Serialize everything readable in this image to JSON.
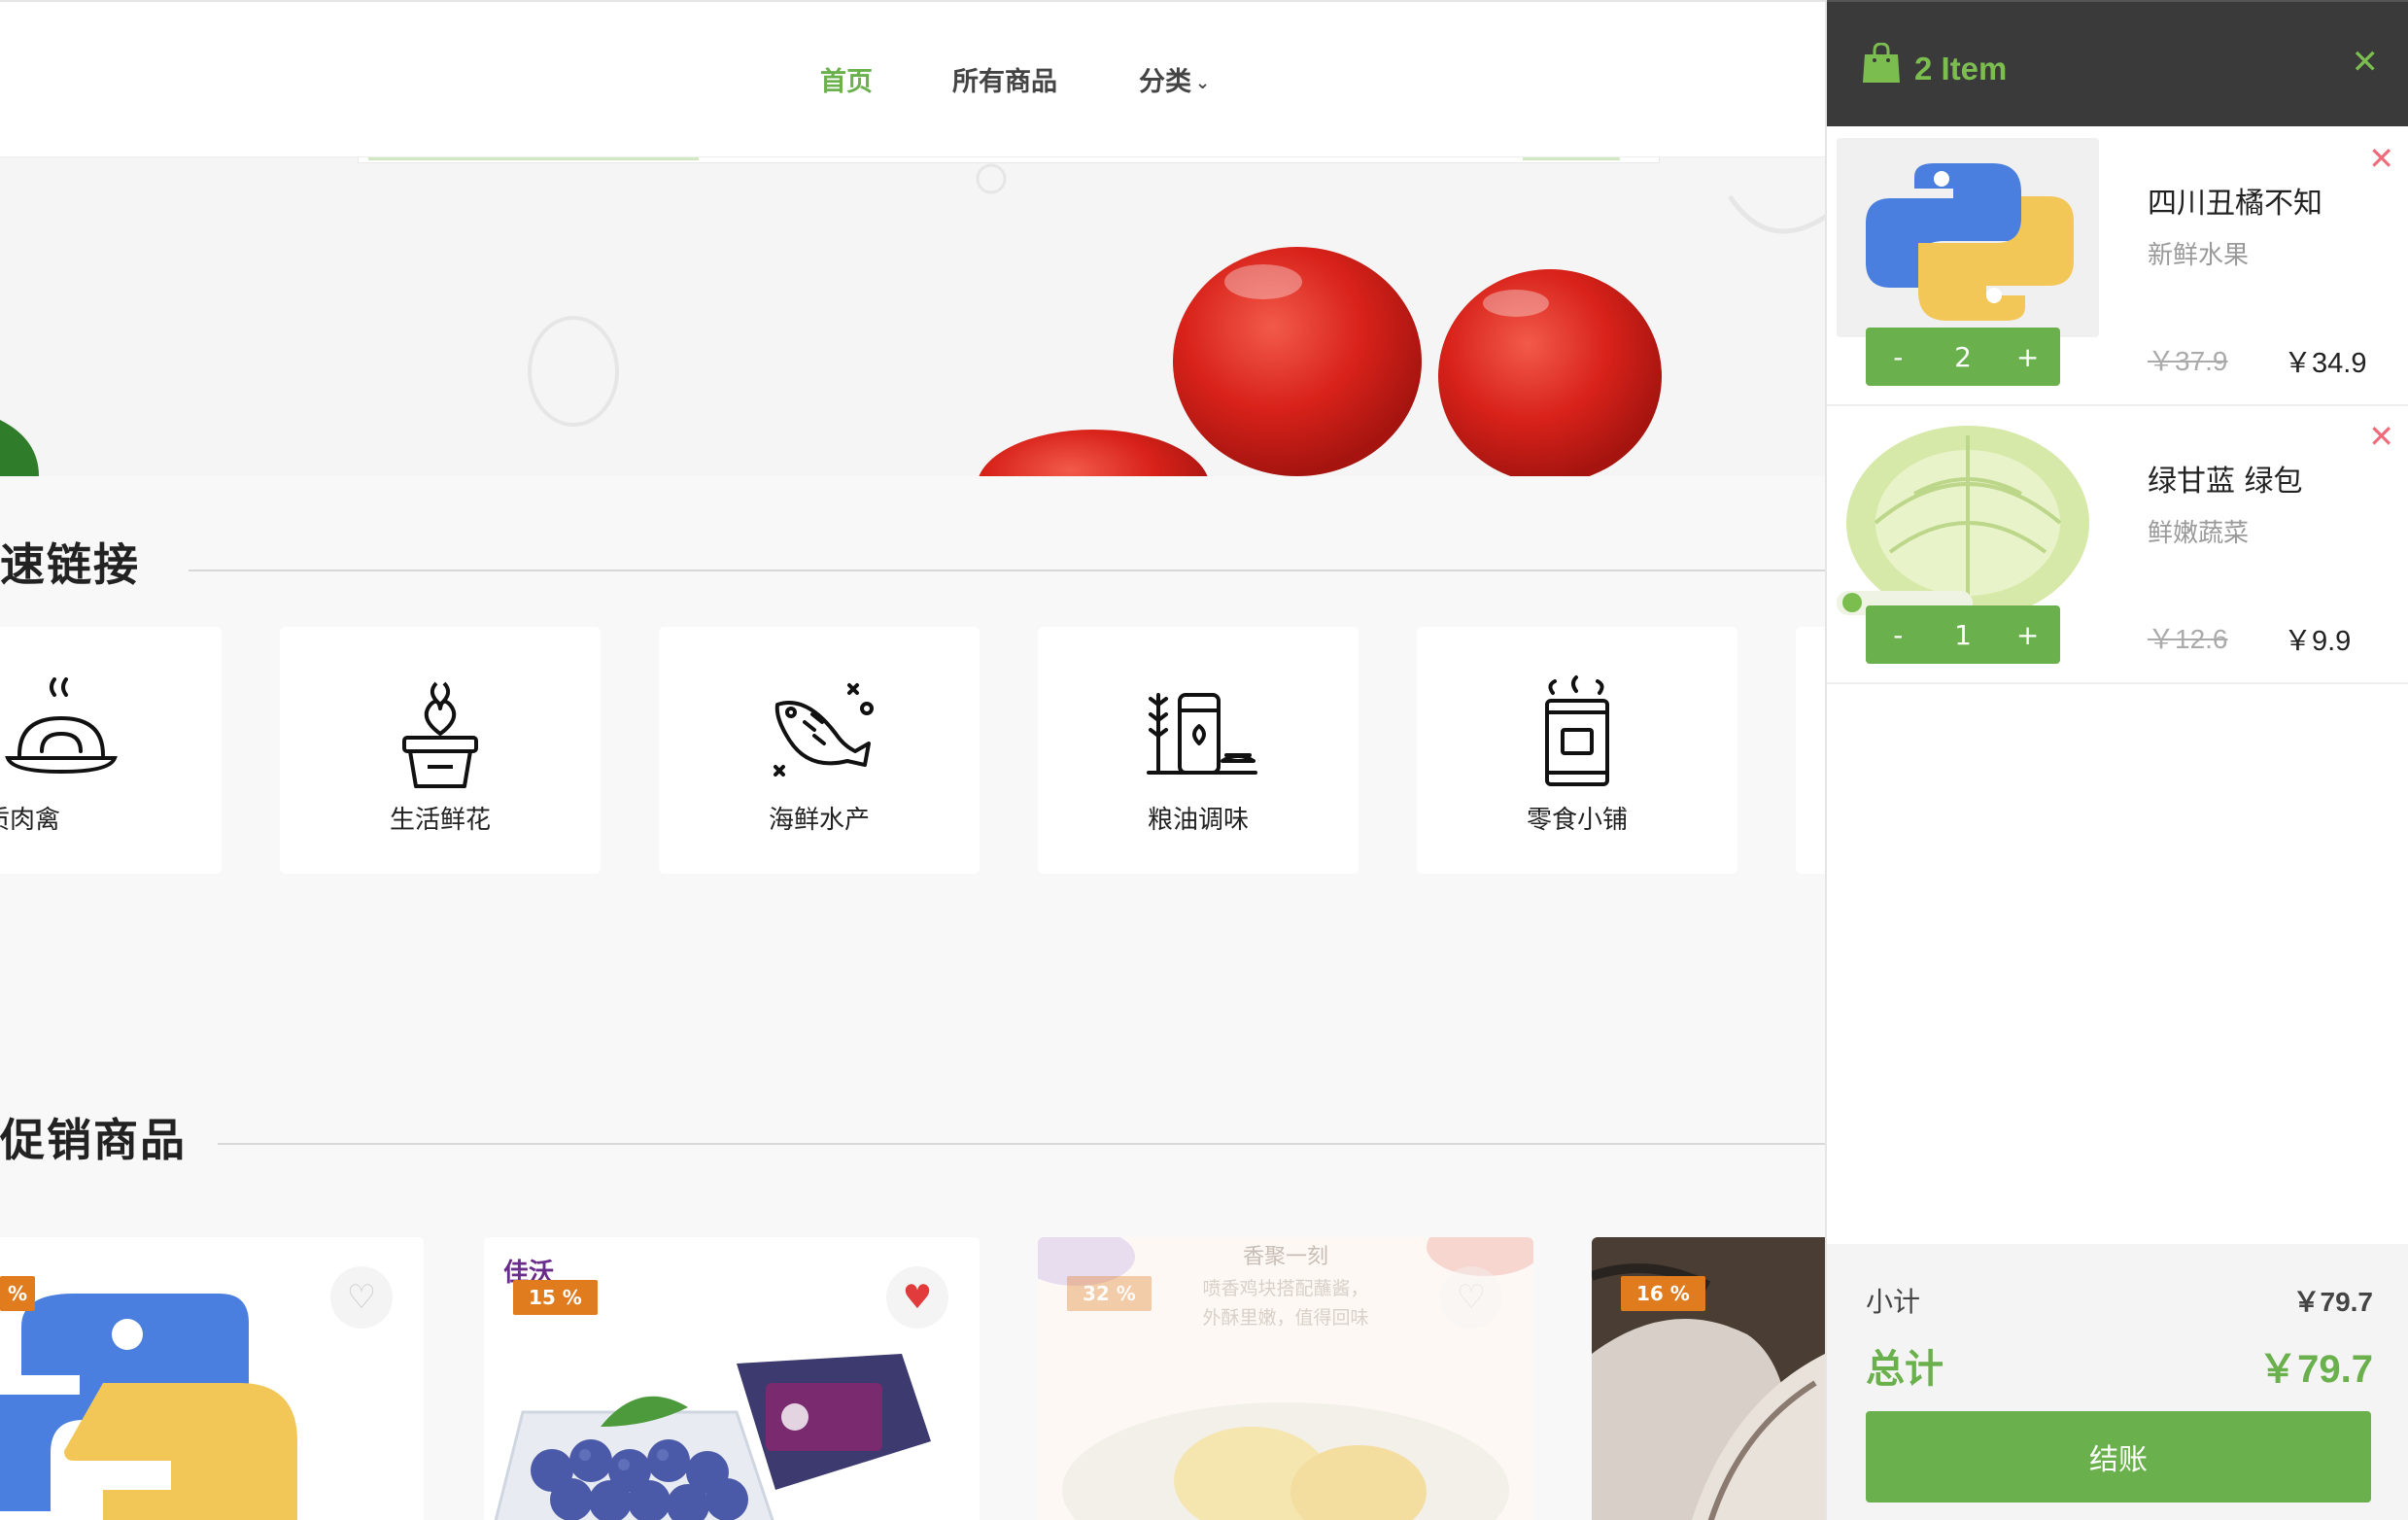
{
  "nav": {
    "items": [
      {
        "label": "首页"
      },
      {
        "label": "所有商品"
      },
      {
        "label": "分类"
      }
    ]
  },
  "sections": {
    "quick_links": "速链接",
    "promo": "促销商品"
  },
  "categories": [
    {
      "label": "优质肉禽",
      "icon": "meat-dish-icon"
    },
    {
      "label": "生活鲜花",
      "icon": "flower-pot-icon"
    },
    {
      "label": "海鲜水产",
      "icon": "fish-icon"
    },
    {
      "label": "粮油调味",
      "icon": "grain-jar-icon"
    },
    {
      "label": "零食小铺",
      "icon": "snack-bag-icon"
    }
  ],
  "products": [
    {
      "badge": "%",
      "liked": false
    },
    {
      "badge": "15 %",
      "liked": true,
      "brand": "佳沃"
    },
    {
      "badge": "32 %",
      "liked": false,
      "overlay_title": "香聚一刻",
      "overlay_line1": "喷香鸡块搭配蘸酱，",
      "overlay_line2": "外酥里嫩，值得回味"
    },
    {
      "badge": "16 %",
      "liked": false
    }
  ],
  "cart": {
    "count_label": "2 Item",
    "items": [
      {
        "name": "四川丑橘不知",
        "category": "新鲜水果",
        "qty": "2",
        "old_price": "￥37.9",
        "price": "￥34.9"
      },
      {
        "name": "绿甘蓝 绿包",
        "category": "鲜嫩蔬菜",
        "qty": "1",
        "old_price": "￥12.6",
        "price": "￥9.9"
      }
    ],
    "subtotal_label": "小计",
    "subtotal": "￥79.7",
    "total_label": "总计",
    "total": "￥79.7",
    "checkout_label": "结账"
  },
  "colors": {
    "accent": "#6ab04c",
    "header_dark": "#3a3a3a",
    "badge": "#e07b1e",
    "remove": "#ef6b7a"
  }
}
